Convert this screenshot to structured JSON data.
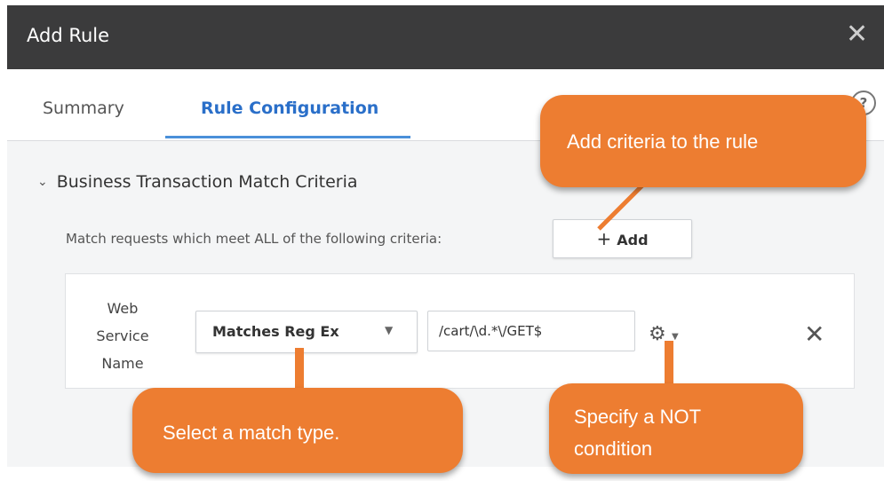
{
  "dialog": {
    "title": "Add Rule",
    "close_icon": "close-icon"
  },
  "tabs": [
    {
      "label": "Summary",
      "active": false
    },
    {
      "label": "Rule Configuration",
      "active": true
    }
  ],
  "help": {
    "label": "?"
  },
  "section": {
    "title": "Business Transaction Match Criteria",
    "expanded": true,
    "match_text": "Match requests which meet ALL of the following criteria:",
    "add_button": {
      "icon": "+",
      "label": "Add"
    }
  },
  "criteria": {
    "field_label": "Web Service Name",
    "match_type": "Matches Reg Ex",
    "value": "/cart/\\d.*\\/GET$"
  },
  "callouts": {
    "add": "Add criteria to the rule",
    "match": "Select a match type.",
    "not": "Specify a NOT\ncondition"
  },
  "colors": {
    "callout": "#ed7d31",
    "titlebar": "#3b3b3c",
    "accent": "#2a6fc9"
  }
}
